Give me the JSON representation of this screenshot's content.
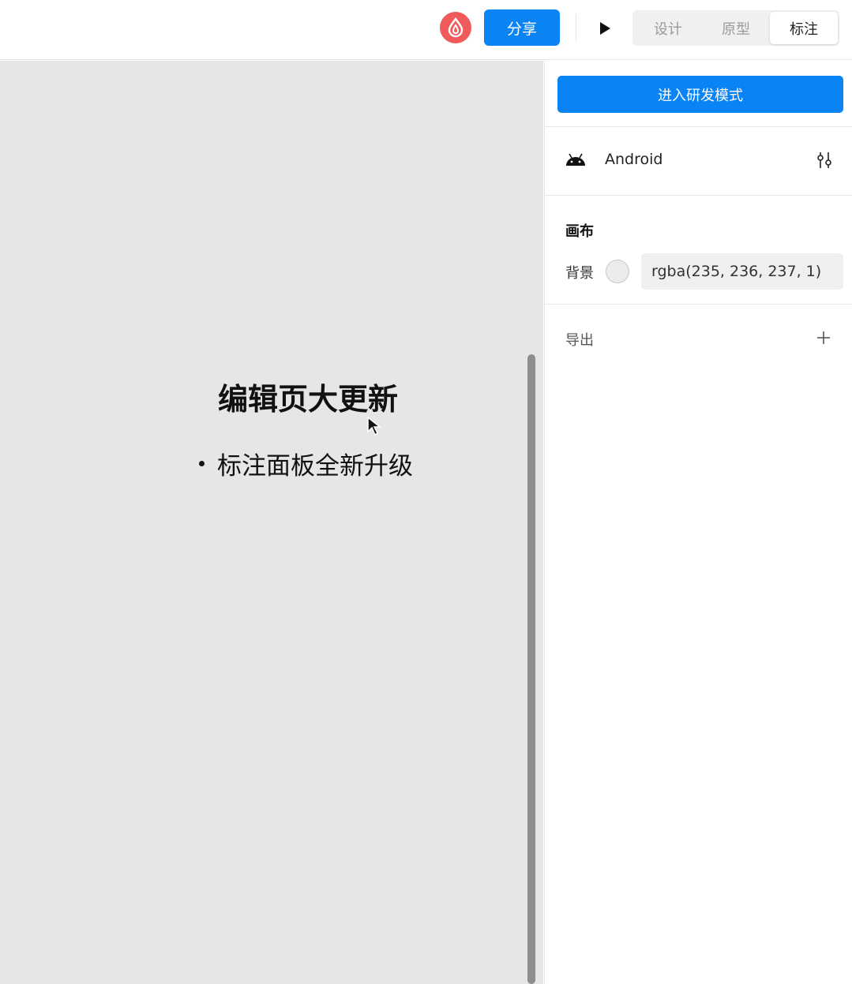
{
  "toolbar": {
    "share_label": "分享",
    "modes": [
      {
        "label": "设计",
        "active": false
      },
      {
        "label": "原型",
        "active": false
      },
      {
        "label": "标注",
        "active": true
      }
    ]
  },
  "canvas": {
    "title": "编辑页大更新",
    "bullet": "标注面板全新升级"
  },
  "panel": {
    "dev_mode_label": "进入研发模式",
    "platform": "Android",
    "canvas_section_title": "画布",
    "background_label": "背景",
    "background_value": "rgba(235, 236, 237, 1)",
    "export_label": "导出"
  },
  "colors": {
    "accent": "#0a84f5",
    "logo": "#f05a5a",
    "canvas_bg": "#e5e6e6"
  }
}
